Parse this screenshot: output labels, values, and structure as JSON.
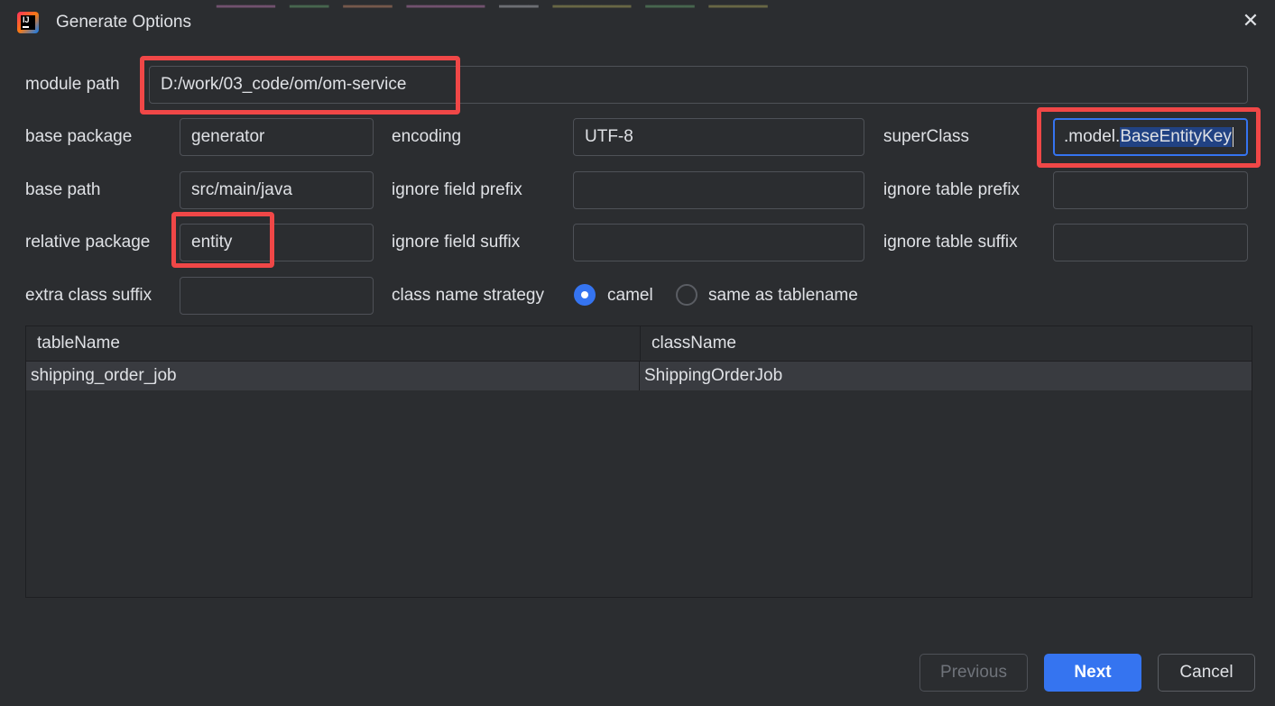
{
  "window": {
    "title": "Generate Options",
    "close_glyph": "✕"
  },
  "form": {
    "module_path": {
      "label": "module path",
      "value": "D:/work/03_code/om/om-service"
    },
    "base_package": {
      "label": "base package",
      "value": "generator"
    },
    "encoding": {
      "label": "encoding",
      "value": "UTF-8"
    },
    "super_class": {
      "label": "superClass",
      "value_prefix": ".model.",
      "value_selected": "BaseEntityKey"
    },
    "base_path": {
      "label": "base path",
      "value": "src/main/java"
    },
    "ignore_field_prefix": {
      "label": "ignore field prefix",
      "value": ""
    },
    "ignore_table_prefix": {
      "label": "ignore table prefix",
      "value": ""
    },
    "relative_package": {
      "label": "relative package",
      "value": "entity"
    },
    "ignore_field_suffix": {
      "label": "ignore field suffix",
      "value": ""
    },
    "ignore_table_suffix": {
      "label": "ignore table suffix",
      "value": ""
    },
    "extra_class_suffix": {
      "label": "extra class suffix",
      "value": ""
    },
    "class_name_strategy": {
      "label": "class name strategy",
      "options": [
        "camel",
        "same as tablename"
      ],
      "selected": "camel"
    }
  },
  "table": {
    "columns": [
      "tableName",
      "className"
    ],
    "rows": [
      [
        "shipping_order_job",
        "ShippingOrderJob"
      ]
    ]
  },
  "buttons": {
    "previous": "Previous",
    "next": "Next",
    "cancel": "Cancel"
  },
  "colors": {
    "background": "#2b2d30",
    "accent": "#3574f0",
    "highlight_border": "#f04747",
    "text": "#dfe1e5"
  }
}
